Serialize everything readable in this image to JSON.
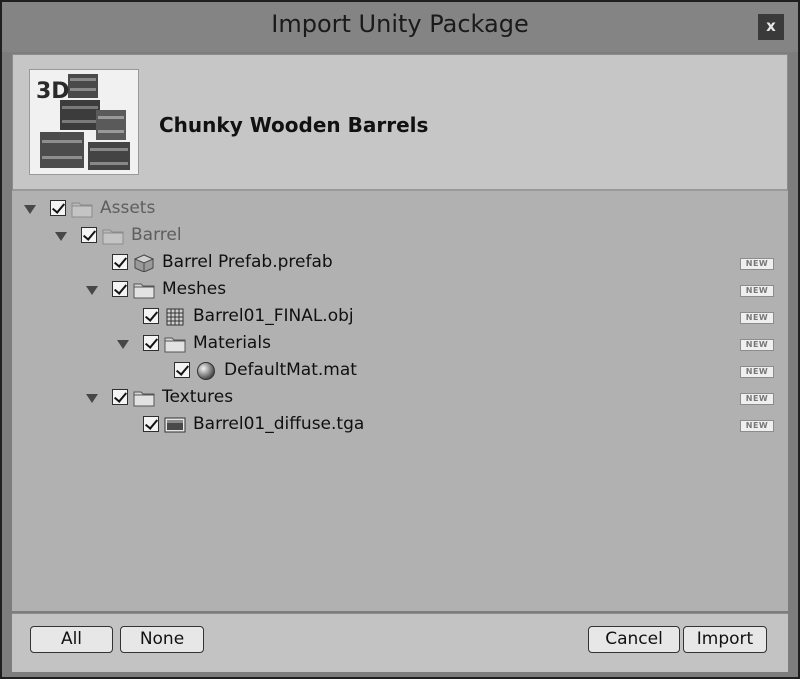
{
  "window": {
    "title": "Import Unity Package",
    "close_label": "x"
  },
  "header": {
    "package_name": "Chunky Wooden Barrels",
    "logo_text": "3D",
    "logo_icon": "barrels-logo-icon"
  },
  "tree": {
    "new_badge": "NEW",
    "items": [
      {
        "label": "Assets",
        "icon": "folder-icon",
        "expandable": true,
        "checked": true,
        "is_new": false
      },
      {
        "label": "Barrel",
        "icon": "folder-icon",
        "expandable": true,
        "checked": true,
        "is_new": false
      },
      {
        "label": "Barrel Prefab.prefab",
        "icon": "prefab-icon",
        "expandable": false,
        "checked": true,
        "is_new": true
      },
      {
        "label": "Meshes",
        "icon": "folder-icon",
        "expandable": true,
        "checked": true,
        "is_new": true
      },
      {
        "label": "Barrel01_FINAL.obj",
        "icon": "mesh-icon",
        "expandable": false,
        "checked": true,
        "is_new": true
      },
      {
        "label": "Materials",
        "icon": "folder-icon",
        "expandable": true,
        "checked": true,
        "is_new": true
      },
      {
        "label": "DefaultMat.mat",
        "icon": "material-sphere-icon",
        "expandable": false,
        "checked": true,
        "is_new": true
      },
      {
        "label": "Textures",
        "icon": "folder-icon",
        "expandable": true,
        "checked": true,
        "is_new": true
      },
      {
        "label": "Barrel01_diffuse.tga",
        "icon": "texture-icon",
        "expandable": false,
        "checked": true,
        "is_new": true
      }
    ]
  },
  "footer": {
    "all_label": "All",
    "none_label": "None",
    "cancel_label": "Cancel",
    "import_label": "Import"
  }
}
